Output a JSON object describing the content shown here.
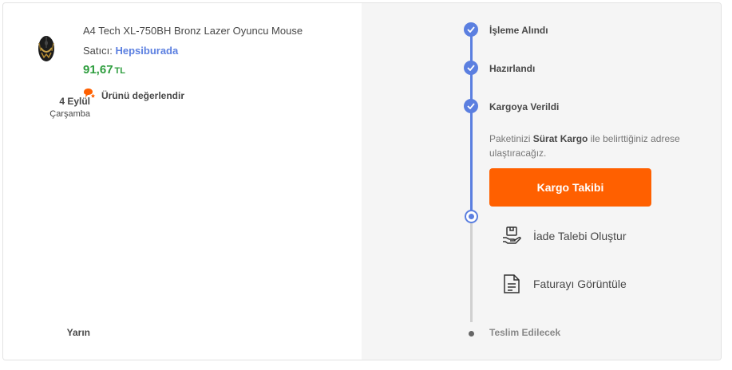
{
  "product": {
    "name": "A4 Tech XL-750BH Bronz Lazer Oyuncu Mouse",
    "seller_prefix": "Satıcı:",
    "seller_name": "Hepsiburada",
    "price": "91,67",
    "currency": "TL",
    "rate_label": "Ürünü değerlendir"
  },
  "timeline": {
    "steps": [
      {
        "label": "İşleme Alındı",
        "status": "done"
      },
      {
        "label": "Hazırlandı",
        "status": "done"
      },
      {
        "label": "Kargoya Verildi",
        "status": "done"
      }
    ],
    "shipped_date": "4 Eylül",
    "shipped_day": "Çarşamba",
    "info_prefix": "Paketinizi",
    "carrier": "Sürat Kargo",
    "info_suffix": "ile belirttiğiniz adrese ulaştıracağız.",
    "track_button": "Kargo Takibi",
    "actions": [
      {
        "label": "İade Talebi Oluştur",
        "icon": "return-box-icon"
      },
      {
        "label": "Faturayı Görüntüle",
        "icon": "invoice-icon"
      }
    ],
    "delivery_day": "Yarın",
    "delivery_label": "Teslim Edilecek"
  },
  "colors": {
    "accent_blue": "#5b7fe0",
    "orange": "#ff6000",
    "price_green": "#2d9d3d"
  }
}
